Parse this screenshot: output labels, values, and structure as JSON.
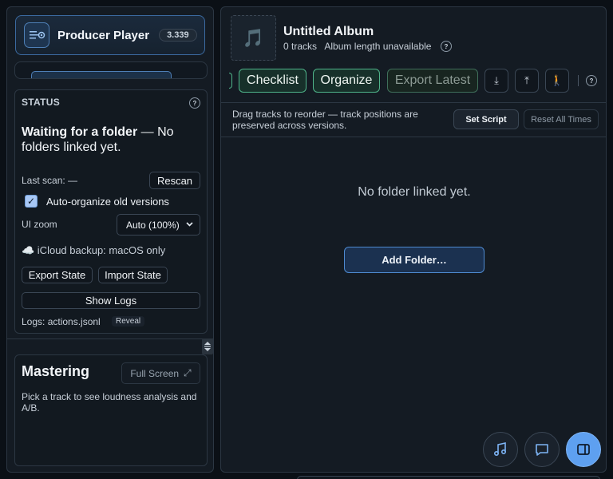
{
  "app": {
    "title": "Producer Player",
    "version": "3.339"
  },
  "status": {
    "heading": "STATUS",
    "help": "?",
    "message_strong": "Waiting for a folder",
    "message_rest": " — No folders linked yet.",
    "last_scan_label": "Last scan: —",
    "rescan_label": "Rescan",
    "auto_organize_label": "Auto-organize old versions",
    "auto_organize_checked": true,
    "ui_zoom_label": "UI zoom",
    "ui_zoom_value": "Auto (100%)",
    "icloud_text": "☁️ iCloud backup: macOS only",
    "export_state_label": "Export State",
    "import_state_label": "Import State",
    "show_logs_label": "Show Logs",
    "logs_file_text": "Logs: actions.jsonl",
    "reveal_label": "Reveal"
  },
  "mastering": {
    "title": "Mastering",
    "full_screen_label": "Full Screen",
    "full_screen_glyph": "⤢",
    "description": "Pick a track to see loudness analysis and A/B."
  },
  "album": {
    "title": "Untitled Album",
    "track_count": "0 tracks",
    "length_text": "Album length unavailable",
    "help": "?",
    "art_icon": "music-note-icon"
  },
  "toolbar": {
    "checklist_label": "Checklist",
    "organize_label": "Organize",
    "export_latest_label": "Export Latest",
    "download_glyph": "⤓",
    "upload_glyph": "⤒",
    "walk_glyph": "🚶",
    "help": "?"
  },
  "hint": {
    "text": "Drag tracks to reorder — track positions are preserved across versions.",
    "set_script_label": "Set Script",
    "reset_times_label": "Reset All Times"
  },
  "empty_state": {
    "message": "No folder linked yet.",
    "add_folder_label": "Add Folder…"
  },
  "fabs": {
    "music_icon": "music-icon",
    "chat_icon": "chat-icon",
    "sidebar_icon": "sidebar-toggle-icon",
    "active_color": "#5ea0f0"
  },
  "colors": {
    "accent_blue": "#4e8ad0",
    "accent_green": "#4fb58a",
    "background": "#0b1016"
  }
}
